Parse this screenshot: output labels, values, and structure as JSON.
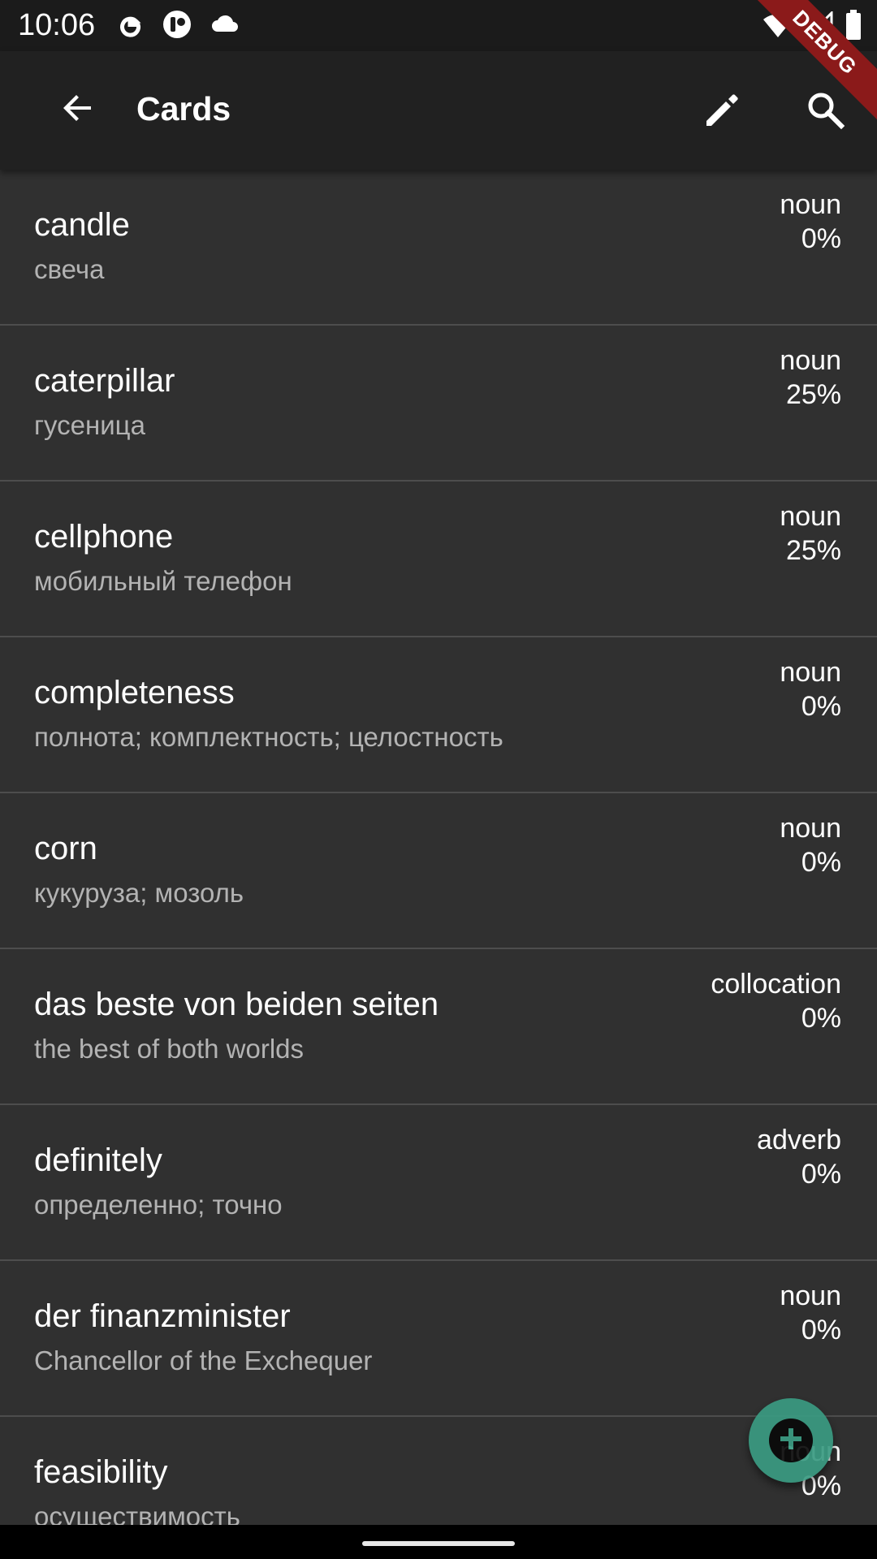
{
  "status_bar": {
    "time": "10:06",
    "left_icons": [
      "google-icon",
      "notification-app-icon",
      "cloud-icon"
    ],
    "right_icons": [
      "wifi-icon",
      "signal-icon",
      "battery-icon"
    ]
  },
  "debug_banner": "DEBUG",
  "app_bar": {
    "title": "Cards",
    "back_icon": "arrow-back-icon",
    "actions": [
      "edit-icon",
      "search-icon"
    ]
  },
  "cards": [
    {
      "term": "candle",
      "translation": "свеча",
      "type": "noun",
      "progress": "0%"
    },
    {
      "term": "caterpillar",
      "translation": "гусеница",
      "type": "noun",
      "progress": "25%"
    },
    {
      "term": "cellphone",
      "translation": "мобильный телефон",
      "type": "noun",
      "progress": "25%"
    },
    {
      "term": "completeness",
      "translation": "полнота; комплектность; целостность",
      "type": "noun",
      "progress": "0%"
    },
    {
      "term": "corn",
      "translation": "кукуруза; мозоль",
      "type": "noun",
      "progress": "0%"
    },
    {
      "term": "das beste von beiden seiten",
      "translation": "the best of both worlds",
      "type": "collocation",
      "progress": "0%"
    },
    {
      "term": "definitely",
      "translation": "определенно; точно",
      "type": "adverb",
      "progress": "0%"
    },
    {
      "term": "der finanzminister",
      "translation": "Chancellor of the Exchequer",
      "type": "noun",
      "progress": "0%"
    },
    {
      "term": "feasibility",
      "translation": "осуществимость",
      "type": "noun",
      "progress": "0%"
    }
  ],
  "fab": {
    "icon": "add-icon"
  },
  "colors": {
    "background": "#303030",
    "app_bar": "#212121",
    "status_bar": "#1b1b1b",
    "fab": "#3a9b82",
    "debug_banner": "#8b1a1a"
  }
}
